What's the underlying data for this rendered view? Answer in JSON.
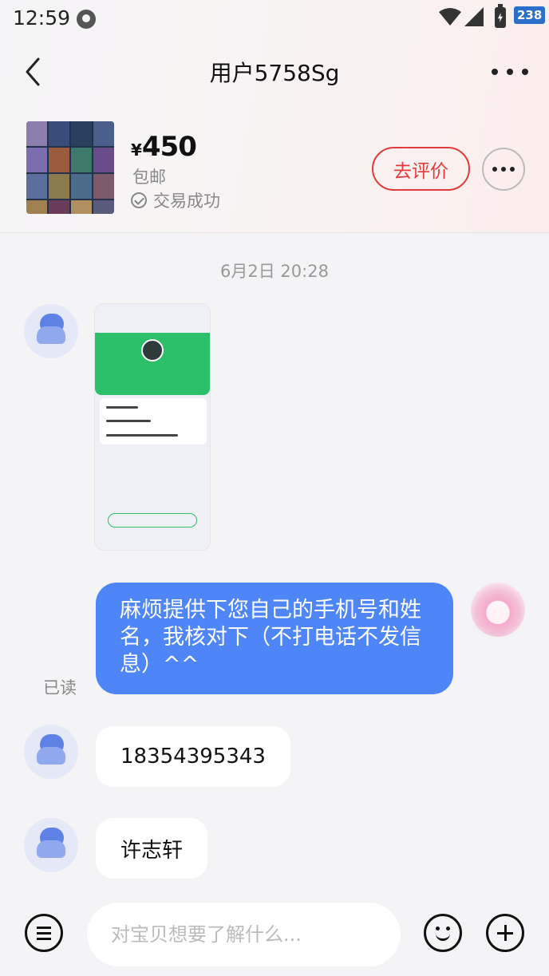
{
  "status_bar": {
    "time": "12:59",
    "notification_count": "238",
    "icons": [
      "app-badge-icon",
      "wifi-icon",
      "signal-icon",
      "battery-charging-icon"
    ]
  },
  "header": {
    "title": "用户5758Sg",
    "back_icon": "chevron-left-icon",
    "more_icon": "more-horizontal-icon"
  },
  "product": {
    "price_symbol": "¥",
    "price": "450",
    "shipping": "包邮",
    "status": "交易成功",
    "review_label": "去评价",
    "thumbnail_icon": "product-thumbnail-image"
  },
  "chat": {
    "timestamp": "6月2日 20:28",
    "messages": [
      {
        "sender": "other",
        "type": "image"
      },
      {
        "sender": "self",
        "text": "麻烦提供下您自己的手机号和姓名，我核对下（不打电话不发信息）^^",
        "read": "已读"
      },
      {
        "sender": "other",
        "text": "18354395343"
      },
      {
        "sender": "other",
        "text": "许志轩"
      }
    ]
  },
  "input_bar": {
    "placeholder": "对宝贝想要了解什么...",
    "value": "",
    "icons": [
      "menu-icon",
      "emoji-icon",
      "add-icon"
    ]
  },
  "colors": {
    "accent_blue": "#4f86f7",
    "review_red": "#e03c3c",
    "background": "#f4f4f6"
  }
}
